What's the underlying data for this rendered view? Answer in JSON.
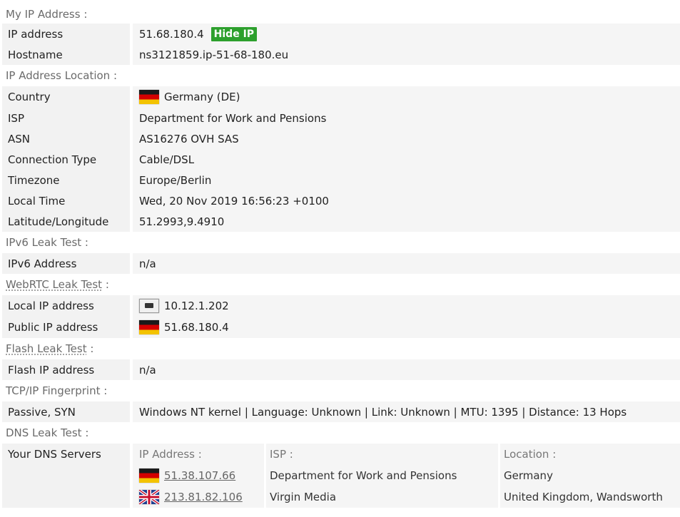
{
  "sections": {
    "my_ip": "My IP Address :",
    "location": "IP Address Location :",
    "ipv6": "IPv6 Leak Test :",
    "webrtc": "WebRTC Leak Test",
    "webrtc_colon": " :",
    "flash": "Flash Leak Test",
    "flash_colon": " :",
    "tcp": "TCP/IP Fingerprint :",
    "dns": "DNS Leak Test :"
  },
  "my_ip": {
    "ip_label": "IP address",
    "ip_value": "51.68.180.4",
    "hide_button": "Hide IP",
    "hostname_label": "Hostname",
    "hostname_value": "ns3121859.ip-51-68-180.eu"
  },
  "location": {
    "country_label": "Country",
    "country_value": "Germany (DE)",
    "isp_label": "ISP",
    "isp_value": "Department for Work and Pensions",
    "asn_label": "ASN",
    "asn_value": "AS16276 OVH SAS",
    "conn_label": "Connection Type",
    "conn_value": "Cable/DSL",
    "tz_label": "Timezone",
    "tz_value": "Europe/Berlin",
    "time_label": "Local Time",
    "time_value": "Wed, 20 Nov 2019 16:56:23 +0100",
    "latlon_label": "Latitude/Longitude",
    "latlon_value": "51.2993,9.4910"
  },
  "ipv6": {
    "label": "IPv6 Address",
    "value": "n/a"
  },
  "webrtc": {
    "local_label": "Local IP address",
    "local_value": "10.12.1.202",
    "public_label": "Public IP address",
    "public_value": "51.68.180.4"
  },
  "flash": {
    "label": "Flash IP address",
    "value": "n/a"
  },
  "tcp": {
    "label": "Passive, SYN",
    "value": "Windows NT kernel | Language: Unknown | Link: Unknown | MTU: 1395 | Distance: 13 Hops"
  },
  "dns": {
    "label": "Your DNS Servers",
    "headers": {
      "ip": "IP Address :",
      "isp": "ISP :",
      "location": "Location :"
    },
    "rows": [
      {
        "ip": "51.38.107.66",
        "isp": "Department for Work and Pensions",
        "location": "Germany",
        "flag": "germany-flag"
      },
      {
        "ip": "213.81.82.106",
        "isp": "Virgin Media",
        "location": "United Kingdom, Wandsworth",
        "flag": "uk-flag"
      }
    ]
  },
  "colors": {
    "accent_green": "#2da02d",
    "row_bg": "#f2f2f2"
  }
}
